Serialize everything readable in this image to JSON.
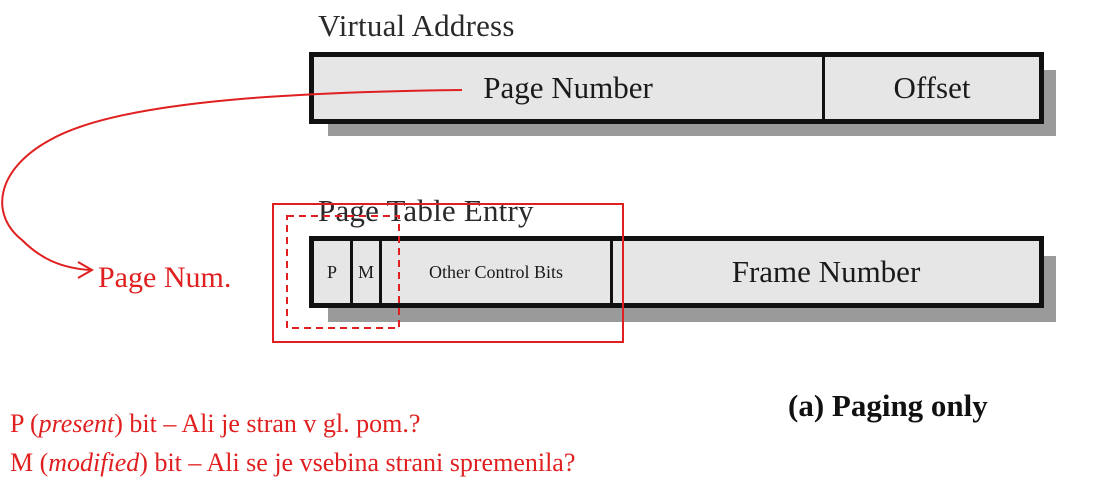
{
  "virtual_address": {
    "title": "Virtual Address",
    "fields": [
      "Page Number",
      "Offset"
    ]
  },
  "page_table_entry": {
    "title": "Page Table Entry",
    "fields": [
      "P",
      "M",
      "Other Control Bits",
      "Frame Number"
    ]
  },
  "arrow_label": "Page Num.",
  "caption": "(a) Paging only",
  "notes": [
    {
      "letter": "P (",
      "term": "present",
      "rest": ") bit – Ali je stran v gl. pom.?"
    },
    {
      "letter": "M (",
      "term": "modified",
      "rest": ") bit – Ali se je vsebina strani spremenila?"
    }
  ],
  "colors": {
    "annotation": "#e02020",
    "field_fill": "#e6e6e6",
    "shadow": "#9a9a9a",
    "border": "#111111"
  }
}
